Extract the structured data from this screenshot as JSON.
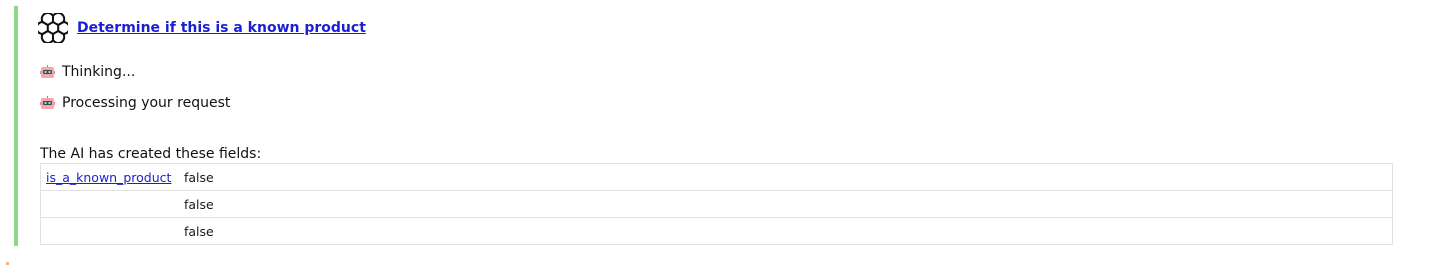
{
  "task": {
    "title": "Determine if this is a known product",
    "icon": "openai-logo-icon"
  },
  "status_messages": [
    {
      "icon": "robot-icon",
      "text": "Thinking..."
    },
    {
      "icon": "robot-icon",
      "text": "Processing your request"
    }
  ],
  "fields_section": {
    "caption": "The AI has created these fields:",
    "rows": [
      {
        "name": "is_a_known_product",
        "value": "false"
      },
      {
        "name": "",
        "value": "false"
      },
      {
        "name": "",
        "value": "false"
      }
    ]
  },
  "colors": {
    "accent_bar": "#8fd68a",
    "link": "#1a1fd6"
  }
}
